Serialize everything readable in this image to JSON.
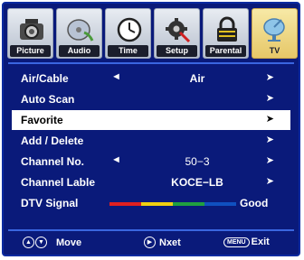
{
  "tabs": [
    {
      "label": "Picture",
      "icon": "camera-icon"
    },
    {
      "label": "Audio",
      "icon": "disc-icon"
    },
    {
      "label": "Time",
      "icon": "clock-icon"
    },
    {
      "label": "Setup",
      "icon": "gear-wrench-icon"
    },
    {
      "label": "Parental",
      "icon": "lock-icon"
    },
    {
      "label": "TV",
      "icon": "satellite-dish-icon"
    }
  ],
  "menu": {
    "air_cable_label": "Air/Cable",
    "air_cable_value": "Air",
    "auto_scan_label": "Auto Scan",
    "favorite_label": "Favorite",
    "add_delete_label": "Add / Delete",
    "channel_no_label": "Channel No.",
    "channel_no_value": "50−3",
    "channel_lable_label": "Channel Lable",
    "channel_lable_value": "KOCE−LB",
    "dtv_signal_label": "DTV Signal",
    "dtv_signal_value": "Good",
    "left_arrow": "◄",
    "right_arrow": "➤"
  },
  "signal_colors": [
    "#e02020",
    "#f0d010",
    "#20a040",
    "#1050c0"
  ],
  "help": {
    "move_label": "Move",
    "next_label": "Nxet",
    "exit_label": "Exit",
    "menu_badge": "MENU"
  },
  "colors": {
    "background": "#0a1a7a",
    "border": "#3a66e0",
    "selected_row": "#ffffff",
    "active_tab": "#e6c768"
  }
}
